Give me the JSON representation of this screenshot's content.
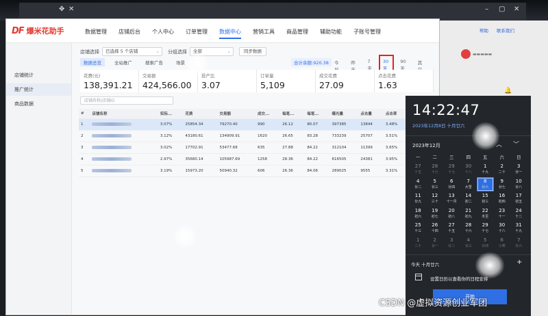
{
  "app": {
    "logo_mark": "DF",
    "logo_text": "爆米花助手",
    "nav": [
      "数据管理",
      "店铺后台",
      "个人中心",
      "订单管理",
      "数据中心",
      "营销工具",
      "商品管理",
      "辅助功能",
      "子账号管理"
    ],
    "active_nav_index": 4
  },
  "sidebar": {
    "items": [
      {
        "label": "店铺统计",
        "active": false
      },
      {
        "label": "推广统计",
        "active": true
      },
      {
        "label": "商品数据",
        "active": false
      }
    ]
  },
  "filters": {
    "shop_label": "店铺选择",
    "shop_value": "已选择 5 个店铺",
    "group_label": "分组选择",
    "group_value": "全部",
    "sync_button": "同步数据"
  },
  "tabs": {
    "items": [
      "数据总览",
      "全站推广",
      "搜索广告",
      "场景"
    ],
    "active_index": 0
  },
  "total_badge": "合计余额:920.38",
  "ranges": {
    "items": [
      "今日",
      "昨天",
      "7天",
      "30天",
      "90天",
      "其它"
    ],
    "selected_index": 3
  },
  "summary_cards": [
    {
      "label": "花费(元)",
      "value": "138,391.21"
    },
    {
      "label": "交易额",
      "value": "424,566.00"
    },
    {
      "label": "投产比",
      "value": "3.07"
    },
    {
      "label": "订单量",
      "value": "5,109"
    },
    {
      "label": "成交花费",
      "value": "27.09"
    },
    {
      "label": "点击花费",
      "value": "1.63"
    }
  ],
  "search": {
    "placeholder": "店铺名称/店铺ID"
  },
  "table": {
    "columns": [
      "#",
      "店铺名称",
      "实际...",
      "花费",
      "交易额",
      "成交...",
      "每笔...",
      "每笔...",
      "曝光量",
      "点击量",
      "点击率",
      "点击..."
    ],
    "rows": [
      {
        "index": "1",
        "c2": "3.07%",
        "c3": "25854.34",
        "c4": "79270.40",
        "c5": "990",
        "c6": "26.12",
        "c7": "80.07",
        "c8": "397385",
        "c9": "13844",
        "c10": "3.48%",
        "c11": "7.51%",
        "selected": true
      },
      {
        "index": "2",
        "c2": "3.12%",
        "c3": "43180.61",
        "c4": "134909.91",
        "c5": "1620",
        "c6": "26.65",
        "c7": "83.28",
        "c8": "733239",
        "c9": "25707",
        "c10": "3.51%",
        "c11": "6.30%",
        "selected": false
      },
      {
        "index": "3",
        "c2": "3.02%",
        "c3": "17702.91",
        "c4": "53477.68",
        "c5": "635",
        "c6": "27.88",
        "c7": "84.22",
        "c8": "312104",
        "c9": "11399",
        "c10": "3.65%",
        "c11": "5.57%",
        "selected": false
      },
      {
        "index": "4",
        "c2": "2.97%",
        "c3": "35680.14",
        "c4": "105987.69",
        "c5": "1258",
        "c6": "28.36",
        "c7": "84.22",
        "c8": "616505",
        "c9": "24381",
        "c10": "3.95%",
        "c11": "5.16%",
        "selected": false
      },
      {
        "index": "5",
        "c2": "3.19%",
        "c3": "15973.20",
        "c4": "50940.32",
        "c5": "606",
        "c6": "26.36",
        "c7": "84.06",
        "c8": "289025",
        "c9": "9555",
        "c10": "3.31%",
        "c11": "6.34%",
        "selected": false
      }
    ]
  },
  "background_window": {
    "links": [
      "帮助",
      "联系我们"
    ]
  },
  "calendar": {
    "time": "14:22:47",
    "date": "2023年12月8日 十月廿六",
    "month": "2023年12月",
    "weekdays": [
      "一",
      "二",
      "三",
      "四",
      "五",
      "六",
      "日"
    ],
    "weeks": [
      [
        {
          "d": "27",
          "l": "十五",
          "dim": true
        },
        {
          "d": "28",
          "l": "十六",
          "dim": true
        },
        {
          "d": "29",
          "l": "十七",
          "dim": true
        },
        {
          "d": "30",
          "l": "十八",
          "dim": true
        },
        {
          "d": "1",
          "l": "十九"
        },
        {
          "d": "2",
          "l": "二十"
        },
        {
          "d": "3",
          "l": "廿一"
        }
      ],
      [
        {
          "d": "4",
          "l": "廿二"
        },
        {
          "d": "5",
          "l": "廿三"
        },
        {
          "d": "6",
          "l": "廿四"
        },
        {
          "d": "7",
          "l": "大雪"
        },
        {
          "d": "8",
          "l": "廿六",
          "today": true
        },
        {
          "d": "9",
          "l": "廿七"
        },
        {
          "d": "10",
          "l": "廿八"
        }
      ],
      [
        {
          "d": "11",
          "l": "廿九"
        },
        {
          "d": "12",
          "l": "三十"
        },
        {
          "d": "13",
          "l": "十一月"
        },
        {
          "d": "14",
          "l": "初二"
        },
        {
          "d": "15",
          "l": "初三"
        },
        {
          "d": "16",
          "l": "初四"
        },
        {
          "d": "17",
          "l": "初五"
        }
      ],
      [
        {
          "d": "18",
          "l": "初六"
        },
        {
          "d": "19",
          "l": "初七"
        },
        {
          "d": "20",
          "l": "初八"
        },
        {
          "d": "21",
          "l": "初九"
        },
        {
          "d": "22",
          "l": "冬至"
        },
        {
          "d": "23",
          "l": "十一"
        },
        {
          "d": "24",
          "l": "十二"
        }
      ],
      [
        {
          "d": "25",
          "l": "十三"
        },
        {
          "d": "26",
          "l": "十四"
        },
        {
          "d": "27",
          "l": "十五"
        },
        {
          "d": "28",
          "l": "十六"
        },
        {
          "d": "29",
          "l": "十七"
        },
        {
          "d": "30",
          "l": "十八"
        },
        {
          "d": "31",
          "l": "十九"
        }
      ],
      [
        {
          "d": "1",
          "l": "二十",
          "dim": true
        },
        {
          "d": "2",
          "l": "廿一",
          "dim": true
        },
        {
          "d": "3",
          "l": "廿二",
          "dim": true
        },
        {
          "d": "4",
          "l": "廿三",
          "dim": true
        },
        {
          "d": "5",
          "l": "廿四",
          "dim": true
        },
        {
          "d": "6",
          "l": "小寒",
          "dim": true
        },
        {
          "d": "7",
          "l": "廿六",
          "dim": true
        }
      ]
    ],
    "events_title": "今天 十月廿六",
    "events_text": "设置日历以查看你的日程安排",
    "start_button": "开始"
  },
  "watermark": "CSDN @虚拟资源创业军团",
  "colors": {
    "accent": "#2f6fe4",
    "highlight": "#e32222",
    "brand": "#e23b2e"
  }
}
